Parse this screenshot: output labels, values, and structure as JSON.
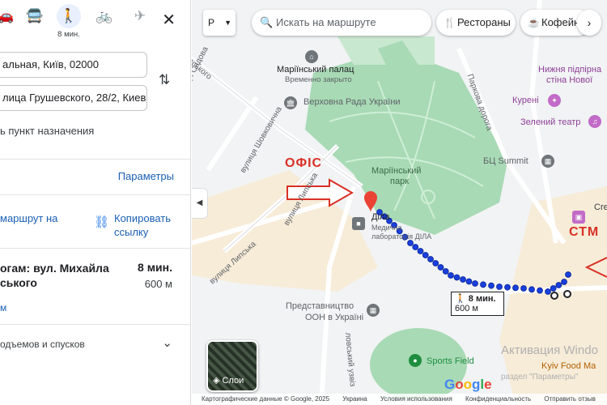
{
  "travel_modes": [
    {
      "name": "car",
      "glyph": "🚗",
      "label": ""
    },
    {
      "name": "transit",
      "glyph": "🚍",
      "label": ""
    },
    {
      "name": "walk",
      "glyph": "🚶",
      "label": "8 мин."
    },
    {
      "name": "bike",
      "glyph": "🚲",
      "label": ""
    },
    {
      "name": "flight",
      "glyph": "✈",
      "label": ""
    }
  ],
  "directions": {
    "origin": "альная, Київ, 02000",
    "destination": "лица Грушевского, 28/2, Киев, 0",
    "add_destination": "ь пункт назначения",
    "options_label": "Параметры",
    "send_route": "маршрут на",
    "copy_link_line1": "Копировать",
    "copy_link_line2": "ссылку",
    "route_title_line1": "огам: вул. Михайла",
    "route_title_line2": "ського",
    "route_time": "8 мин.",
    "route_distance": "600 м",
    "route_more": "м",
    "elevation": "одъемов и спусков"
  },
  "map": {
    "layer_selector": "Р",
    "search_placeholder": "Искать на маршруте",
    "chips": [
      "Рестораны",
      "Кофейн"
    ],
    "labels": {
      "mariinsky_palace": "Маріїнський палац",
      "palace_status": "Временно закрыто",
      "verkhovna_rada": "Верховна Рада України",
      "mariinsky_park": "Маріїнський\nпарк",
      "park_name_line1": "Маріїнський",
      "park_name_line2": "парк",
      "dila_line1": "Діла",
      "dila_line2": "Медична",
      "dila_line3": "лабораторія ДІЛА",
      "un": "Представництво",
      "un_line2": "ООН в Україні",
      "sports_field": "Sports Field",
      "bc_summit": "БЦ Summit",
      "kureni": "Курені",
      "green_theater": "Зелений театр",
      "nizhnya_line1": "Нижня підпірна",
      "nizhnya_line2": "стіна Нової",
      "street_sadova": "вулиця Садова",
      "street_shovkovychna": "вулиця Шовковична",
      "street_lypska": "вулиця Липська",
      "street_lypska2": "вулиця Липська",
      "park_road": "Паркова дорога",
      "street_top": "вського",
      "lovsky_uzviz": "ловський узвіз",
      "cre": "Cre",
      "kyiv_food": "Kyiv Food Ma",
      "activation": "Активация Windo",
      "activation_sub": "раздел \"Параметры\"",
      "ofis": "ОФІС",
      "ctm": "СТМ",
      "layers": "Слои",
      "google": "Google"
    },
    "walk_box_time": "8 мин.",
    "walk_box_dist": "600 м",
    "footer": [
      "Картографические данные © Google, 2025",
      "Украина",
      "Условия использования",
      "Конфиденциальность",
      "Отправить отзыв"
    ]
  },
  "colors": {
    "route": "#1a3fe0",
    "park": "#a8dab5",
    "accent": "#1a73e8",
    "annotation": "#d93025"
  }
}
